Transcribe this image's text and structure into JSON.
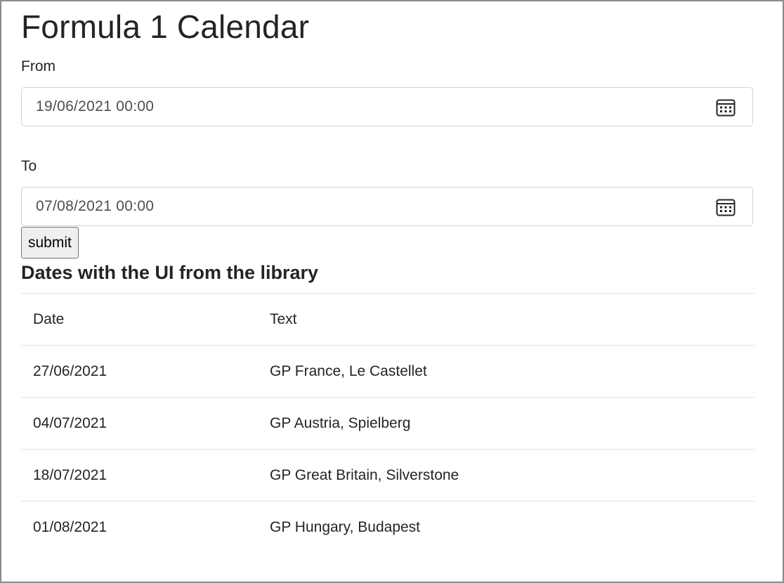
{
  "page": {
    "title": "Formula 1 Calendar"
  },
  "form": {
    "from_label": "From",
    "from_value": "19/06/2021  00:00",
    "to_label": "To",
    "to_value": "07/08/2021  00:00",
    "submit_label": "submit"
  },
  "section": {
    "title": "Dates with the UI from the library"
  },
  "table": {
    "headers": [
      "Date",
      "Text"
    ],
    "rows": [
      {
        "date": "27/06/2021",
        "text": "GP France, Le Castellet"
      },
      {
        "date": "04/07/2021",
        "text": "GP Austria, Spielberg"
      },
      {
        "date": "18/07/2021",
        "text": "GP Great Britain, Silverstone"
      },
      {
        "date": "01/08/2021",
        "text": "GP Hungary, Budapest"
      }
    ]
  },
  "icons": {
    "date_picker": "calendar-icon"
  }
}
